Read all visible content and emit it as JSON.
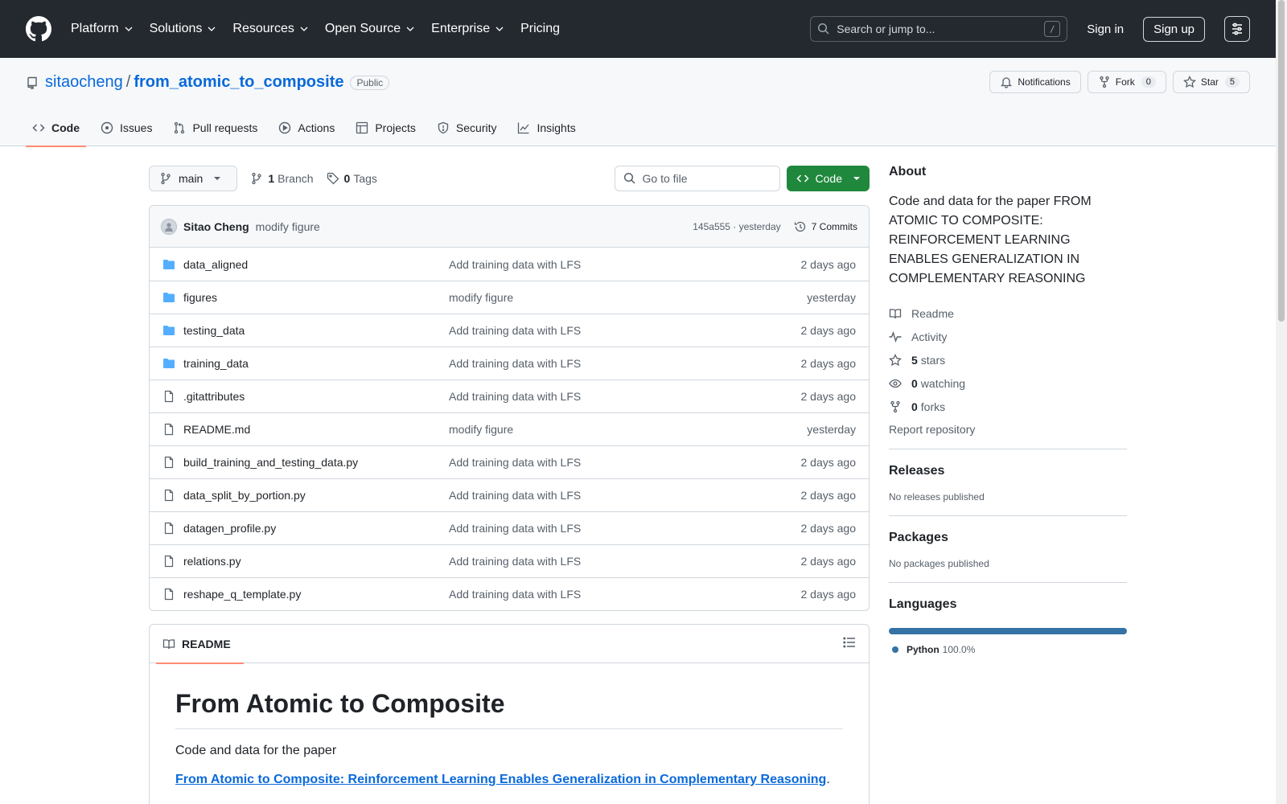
{
  "header": {
    "nav": [
      "Platform",
      "Solutions",
      "Resources",
      "Open Source",
      "Enterprise",
      "Pricing"
    ],
    "nav_has_menu": [
      true,
      true,
      true,
      true,
      true,
      false
    ],
    "search_placeholder": "Search or jump to...",
    "search_shortcut": "/",
    "signin": "Sign in",
    "signup": "Sign up"
  },
  "repo": {
    "owner": "sitaocheng",
    "separator": "/",
    "name": "from_atomic_to_composite",
    "visibility": "Public",
    "notifications": "Notifications",
    "fork_label": "Fork",
    "fork_count": "0",
    "star_label": "Star",
    "star_count": "5",
    "tabs": [
      "Code",
      "Issues",
      "Pull requests",
      "Actions",
      "Projects",
      "Security",
      "Insights"
    ],
    "active_tab": "Code"
  },
  "toolbar": {
    "branch": "main",
    "branch_count": "1",
    "branch_label": "Branch",
    "tag_count": "0",
    "tag_label": "Tags",
    "goto_placeholder": "Go to file",
    "code_button": "Code"
  },
  "commit": {
    "author": "Sitao Cheng",
    "message": "modify figure",
    "hash_time": "145a555 · yesterday",
    "commits": "7 Commits"
  },
  "files": [
    {
      "name": "data_aligned",
      "type": "dir",
      "message": "Add training data with LFS",
      "age": "2 days ago"
    },
    {
      "name": "figures",
      "type": "dir",
      "message": "modify figure",
      "age": "yesterday"
    },
    {
      "name": "testing_data",
      "type": "dir",
      "message": "Add training data with LFS",
      "age": "2 days ago"
    },
    {
      "name": "training_data",
      "type": "dir",
      "message": "Add training data with LFS",
      "age": "2 days ago"
    },
    {
      "name": ".gitattributes",
      "type": "file",
      "message": "Add training data with LFS",
      "age": "2 days ago"
    },
    {
      "name": "README.md",
      "type": "file",
      "message": "modify figure",
      "age": "yesterday"
    },
    {
      "name": "build_training_and_testing_data.py",
      "type": "file",
      "message": "Add training data with LFS",
      "age": "2 days ago"
    },
    {
      "name": "data_split_by_portion.py",
      "type": "file",
      "message": "Add training data with LFS",
      "age": "2 days ago"
    },
    {
      "name": "datagen_profile.py",
      "type": "file",
      "message": "Add training data with LFS",
      "age": "2 days ago"
    },
    {
      "name": "relations.py",
      "type": "file",
      "message": "Add training data with LFS",
      "age": "2 days ago"
    },
    {
      "name": "reshape_q_template.py",
      "type": "file",
      "message": "Add training data with LFS",
      "age": "2 days ago"
    }
  ],
  "readme": {
    "tab": "README",
    "title": "From Atomic to Composite",
    "intro": "Code and data for the paper",
    "paper_link": "From Atomic to Composite: Reinforcement Learning Enables Generalization in Complementary Reasoning",
    "link_suffix": "."
  },
  "about": {
    "heading": "About",
    "description": "Code and data for the paper FROM ATOMIC TO COMPOSITE: REINFORCEMENT LEARNING ENABLES GENERALIZATION IN COMPLEMENTARY REASONING",
    "readme": "Readme",
    "activity": "Activity",
    "stars_count": "5",
    "stars_label": "stars",
    "watching_count": "0",
    "watching_label": "watching",
    "forks_count": "0",
    "forks_label": "forks",
    "report": "Report repository"
  },
  "releases": {
    "heading": "Releases",
    "text": "No releases published"
  },
  "packages": {
    "heading": "Packages",
    "text": "No packages published"
  },
  "languages": {
    "heading": "Languages",
    "name": "Python",
    "percent": "100.0%",
    "fraction": 1.0,
    "color": "#3572A5"
  },
  "colors": {
    "header_bg": "#24292f",
    "link": "#0969da",
    "code_button": "#1f883d",
    "active_tab_underline": "#fd8c73"
  }
}
